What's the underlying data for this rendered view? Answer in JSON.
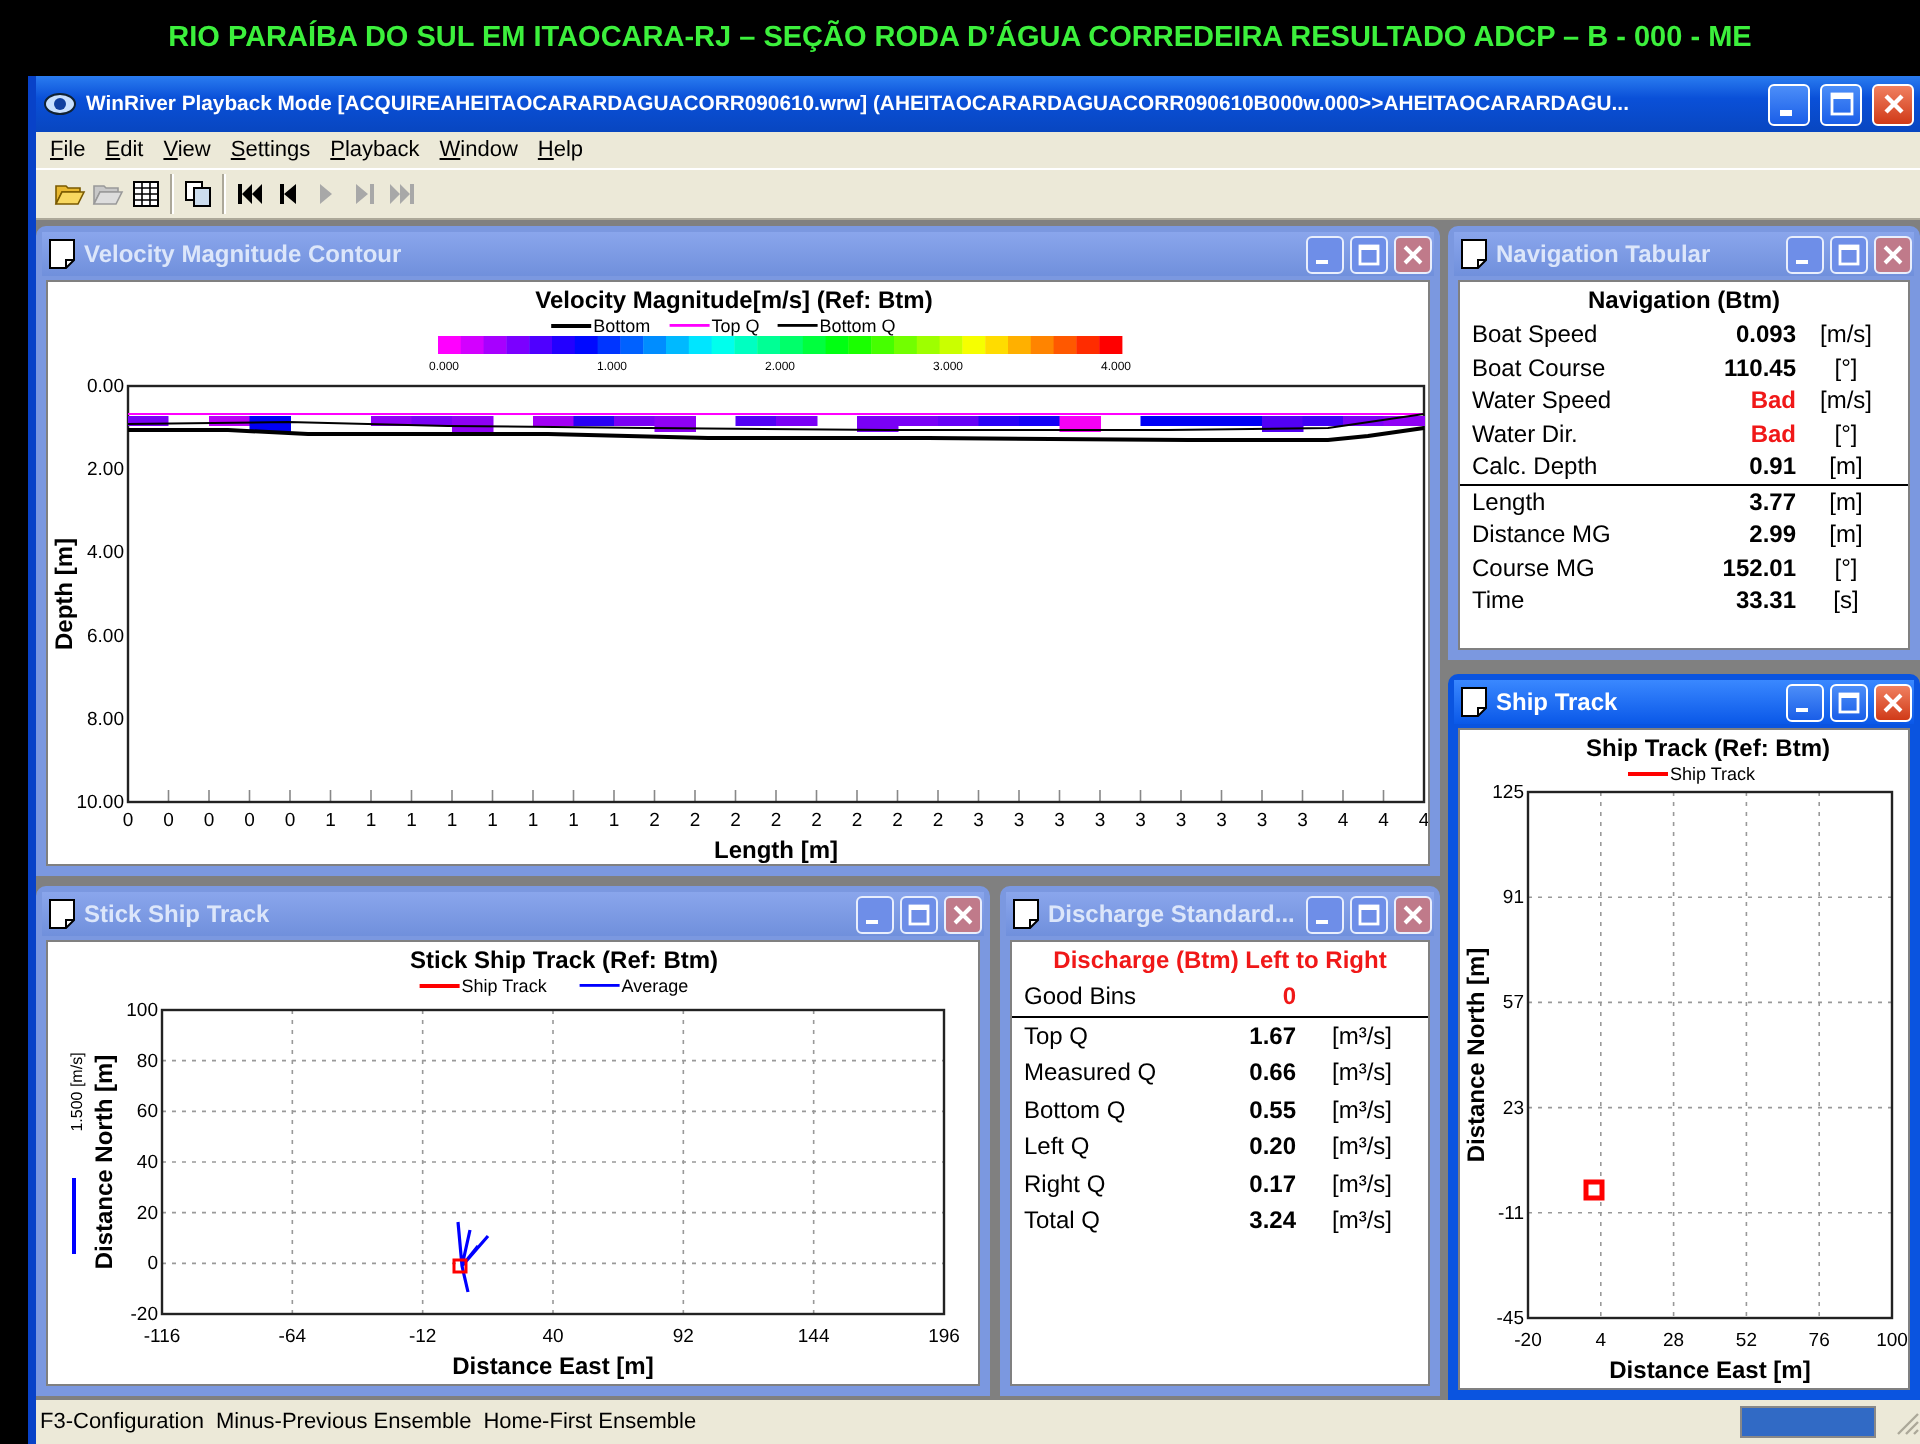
{
  "banner": {
    "text": "RIO PARAÍBA DO SUL EM ITAOCARA-RJ – SEÇÃO RODA D’ÁGUA CORREDEIRA RESULTADO ADCP – B - 000 - ME"
  },
  "app": {
    "title": "WinRiver Playback Mode [ACQUIREAHEITAOCARARDAGUACORR090610.wrw] (AHEITAOCARARDAGUACORR090610B000w.000>>AHEITAOCARARDAGU..."
  },
  "menu": [
    "File",
    "Edit",
    "View",
    "Settings",
    "Playback",
    "Window",
    "Help"
  ],
  "toolbar": {
    "groups": [
      [
        {
          "kind": "open",
          "disabled": false
        },
        {
          "kind": "open",
          "disabled": true
        },
        {
          "kind": "table",
          "disabled": false
        }
      ],
      [
        {
          "kind": "copy",
          "disabled": false
        }
      ],
      [
        {
          "kind": "first",
          "disabled": false
        },
        {
          "kind": "previous",
          "disabled": false
        },
        {
          "kind": "play",
          "disabled": true
        },
        {
          "kind": "next",
          "disabled": true
        },
        {
          "kind": "last",
          "disabled": true
        }
      ]
    ]
  },
  "windows": [
    {
      "kind": "contour",
      "title": "Velocity Magnitude Contour",
      "active": false,
      "chart": {
        "title": "Velocity Magnitude[m/s] (Ref: Btm)",
        "legend": [
          {
            "label": "Bottom",
            "color": "#000000"
          },
          {
            "label": "Top Q",
            "color": "#ff00ff"
          },
          {
            "label": "Bottom Q",
            "color": "#000000"
          }
        ],
        "scale_labels": [
          "0.000",
          "1.000",
          "2.000",
          "3.000",
          "4.000"
        ],
        "yticks": [
          "0.00",
          "2.00",
          "4.00",
          "6.00",
          "8.00",
          "10.00"
        ],
        "xticks": [
          "0",
          "0",
          "0",
          "0",
          "0",
          "1",
          "1",
          "1",
          "1",
          "1",
          "1",
          "1",
          "1",
          "2",
          "2",
          "2",
          "2",
          "2",
          "2",
          "2",
          "2",
          "3",
          "3",
          "3",
          "3",
          "3",
          "3",
          "3",
          "3",
          "3",
          "4",
          "4",
          "4"
        ],
        "xlabel": "Length [m]",
        "ylabel": "Depth [m]"
      }
    },
    {
      "kind": "navigation",
      "title": "Navigation Tabular",
      "active": false,
      "heading": "Navigation (Btm)",
      "groups": [
        {
          "rows": [
            {
              "label": "Boat Speed",
              "value": "0.093",
              "unit": "[m/s]",
              "alert": false
            },
            {
              "label": "Boat Course",
              "value": "110.45",
              "unit": "[°]",
              "alert": false
            },
            {
              "label": "Water Speed",
              "value": "Bad",
              "unit": "[m/s]",
              "alert": true
            },
            {
              "label": "Water Dir.",
              "value": "Bad",
              "unit": "[°]",
              "alert": true
            },
            {
              "label": "Calc. Depth",
              "value": "0.91",
              "unit": "[m]",
              "alert": false
            }
          ]
        },
        {
          "rows": [
            {
              "label": "Length",
              "value": "3.77",
              "unit": "[m]",
              "alert": false
            },
            {
              "label": "Distance MG",
              "value": "2.99",
              "unit": "[m]",
              "alert": false
            },
            {
              "label": "Course MG",
              "value": "152.01",
              "unit": "[°]",
              "alert": false
            },
            {
              "label": "Time",
              "value": "33.31",
              "unit": "[s]",
              "alert": false
            }
          ]
        }
      ]
    },
    {
      "kind": "ship_track",
      "title": "Ship Track",
      "active": true,
      "chart": {
        "title": "Ship Track (Ref: Btm)",
        "legend": [
          {
            "label": "Ship Track",
            "color": "#ff0000"
          }
        ],
        "yticks": [
          "125",
          "91",
          "57",
          "23",
          "-11",
          "-45"
        ],
        "xticks": [
          "-20",
          "4",
          "28",
          "52",
          "76",
          "100"
        ],
        "xlabel": "Distance East [m]",
        "ylabel": "Distance North [m]"
      }
    },
    {
      "kind": "stick_track",
      "title": "Stick Ship Track",
      "active": false,
      "chart": {
        "title": "Stick Ship Track (Ref: Btm)",
        "legend": [
          {
            "label": "Ship Track",
            "color": "#ff0000"
          },
          {
            "label": "Average",
            "color": "#0000ff"
          }
        ],
        "yticks": [
          "100",
          "80",
          "60",
          "40",
          "20",
          "0",
          "-20"
        ],
        "xticks": [
          "-116",
          "-64",
          "-12",
          "40",
          "92",
          "144",
          "196"
        ],
        "xlabel": "Distance East [m]",
        "ylabel": "Distance North [m]",
        "scale_label": "1.500 [m/s]"
      }
    },
    {
      "kind": "discharge",
      "title": "Discharge Standard...",
      "active": false,
      "heading": "Discharge (Btm) Left to Right",
      "groups": [
        {
          "rows": [
            {
              "label": "Good Bins",
              "value": "0",
              "alert": true
            }
          ]
        },
        {
          "rows": [
            {
              "label": "Top Q",
              "value": "1.67",
              "unit": "[m³/s]",
              "alert": false
            },
            {
              "label": "Measured Q",
              "value": "0.66",
              "unit": "[m³/s]",
              "alert": false
            },
            {
              "label": "Bottom Q",
              "value": "0.55",
              "unit": "[m³/s]",
              "alert": false
            },
            {
              "label": "Left Q",
              "value": "0.20",
              "unit": "[m³/s]",
              "alert": false
            },
            {
              "label": "Right Q",
              "value": "0.17",
              "unit": "[m³/s]",
              "alert": false
            },
            {
              "label": "Total Q",
              "value": "3.24",
              "unit": "[m³/s]",
              "alert": false
            }
          ]
        }
      ]
    }
  ],
  "status_bar": {
    "items": [
      "F3-Configuration",
      "Minus-Previous Ensemble",
      "Home-First Ensemble"
    ],
    "progress": {
      "level": 1
    }
  }
}
